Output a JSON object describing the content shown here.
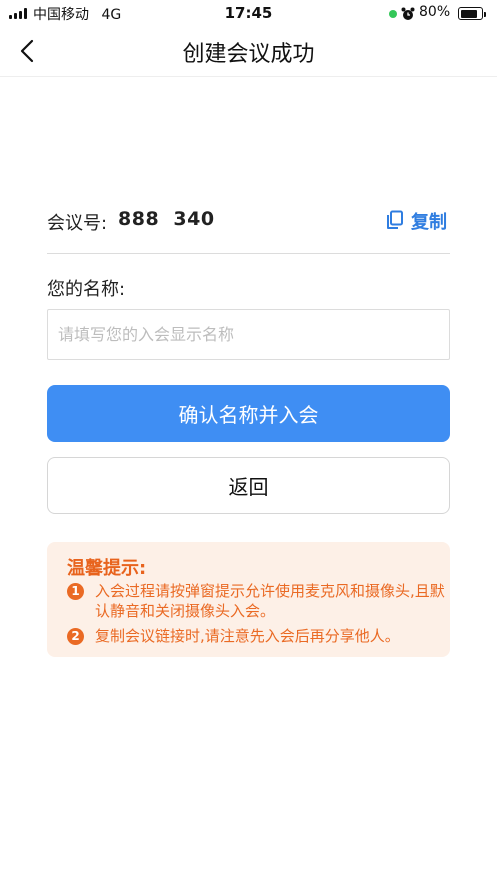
{
  "status_bar": {
    "carrier": "中国移动",
    "network": "4G",
    "time": "17:45",
    "battery_percent": "80%",
    "battery_level": 0.8
  },
  "nav": {
    "title": "创建会议成功",
    "back_icon": "chevron-left-icon"
  },
  "meeting": {
    "label": "会议号:",
    "number": "888  340",
    "copy_label": "复制",
    "copy_icon": "copy-icon"
  },
  "name_field": {
    "label": "您的名称:",
    "placeholder": "请填写您的入会显示名称",
    "value": ""
  },
  "buttons": {
    "confirm": "确认名称并入会",
    "back": "返回"
  },
  "tips": {
    "title": "温馨提示:",
    "items": [
      {
        "num": "1",
        "text": "入会过程请按弹窗提示允许使用麦克风和摄像头,且默认静音和关闭摄像头入会。"
      },
      {
        "num": "2",
        "text": "复制会议链接时,请注意先入会后再分享他人。"
      }
    ]
  },
  "colors": {
    "primary": "#3f8ef3",
    "link": "#2f7de0",
    "tip_text": "#ea6a24",
    "tip_bg": "#fdf0e7"
  }
}
